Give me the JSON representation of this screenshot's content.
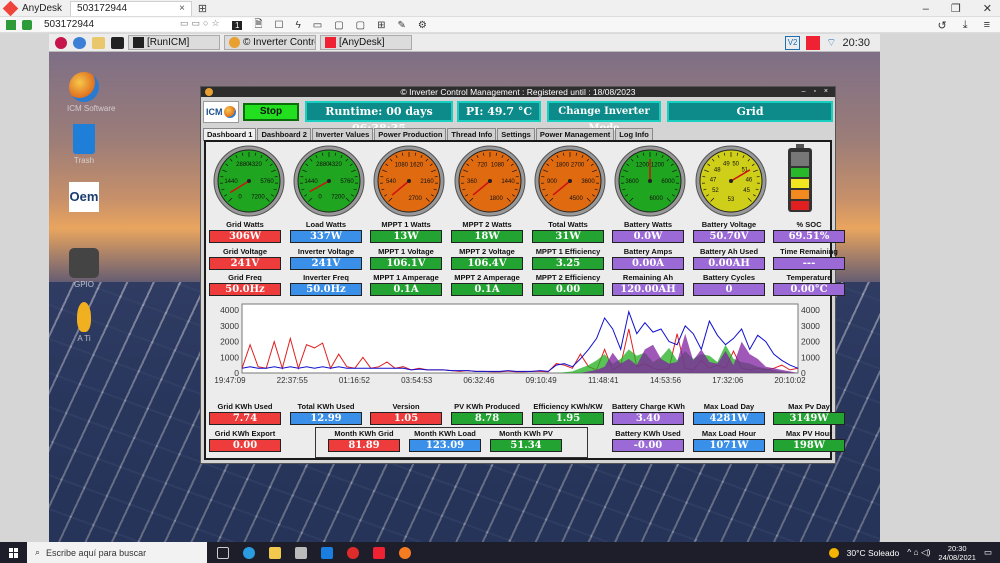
{
  "anydesk": {
    "app_name": "AnyDesk",
    "tab_label": "503172944",
    "tab_close": "×",
    "new_tab": "⊞",
    "address": "503172944",
    "toolbar_number": "1",
    "window_controls": [
      "–",
      "❐",
      "✕"
    ]
  },
  "remote_panel": {
    "tasks": [
      "[RunICM]",
      "© Inverter Control...",
      "[AnyDesk]"
    ],
    "v2": "V2",
    "clock": "20:30"
  },
  "desktop_icons": [
    {
      "label": "ICM Software",
      "icon": "icm-globe-icon"
    },
    {
      "label": "Trash",
      "icon": "trash-icon"
    },
    {
      "label": "Oem",
      "icon": "oem-icon"
    },
    {
      "label": "GPIO",
      "icon": "toggle-icon"
    },
    {
      "label": "A Ti",
      "icon": "bulb-icon"
    }
  ],
  "icm": {
    "title": "© Inverter Control Management : Registered until : 18/08/2023",
    "logo": "ICM",
    "stop_label": "Stop",
    "runtime": "Runtime: 00 days 06:38:35",
    "pi_temp": "PI: 49.7 °C",
    "change_mode": "Change Inverter Mode",
    "mode": "Grid",
    "tabs": [
      "Dashboard 1",
      "Dashboard 2",
      "Inverter Values",
      "Power Production",
      "Thread Info",
      "Settings",
      "Power Management",
      "Log Info"
    ],
    "gauges": [
      {
        "ticks": [
          "2880",
          "4320",
          "1440",
          "5760",
          "0",
          "7200"
        ],
        "color": "#1fa51f",
        "needle": 0.05
      },
      {
        "ticks": [
          "2880",
          "4320",
          "1440",
          "5760",
          "0",
          "7200"
        ],
        "color": "#1fa51f",
        "needle": 0.06
      },
      {
        "ticks": [
          "1080",
          "1620",
          "540",
          "2160",
          "2700"
        ],
        "color": "#e06a10",
        "needle": 0.02
      },
      {
        "ticks": [
          "720",
          "1080",
          "360",
          "1440",
          "1800"
        ],
        "color": "#e06a10",
        "needle": 0.02
      },
      {
        "ticks": [
          "1800",
          "2700",
          "900",
          "3600",
          "4500"
        ],
        "color": "#e06a10",
        "needle": 0.02
      },
      {
        "ticks": [
          "1200",
          "1200",
          "3600",
          "6000",
          "6000"
        ],
        "color": "#1fa51f",
        "needle": 0.5
      },
      {
        "ticks": [
          "49",
          "50",
          "48",
          "51",
          "47",
          "46",
          "52",
          "45",
          "53"
        ],
        "color": "#cfcf1a",
        "needle": 0.72
      }
    ],
    "rows": [
      [
        {
          "label": "Grid Watts",
          "value": "306W",
          "color": "red"
        },
        {
          "label": "Load Watts",
          "value": "337W",
          "color": "blue"
        },
        {
          "label": "MPPT 1 Watts",
          "value": "13W",
          "color": "green"
        },
        {
          "label": "MPPT 2 Watts",
          "value": "18W",
          "color": "green"
        },
        {
          "label": "Total Watts",
          "value": "31W",
          "color": "green"
        },
        {
          "label": "Battery Watts",
          "value": "0.0W",
          "color": "purple"
        },
        {
          "label": "Battery Voltage",
          "value": "50.70V",
          "color": "purple"
        },
        {
          "label": "% SOC",
          "value": "69.51%",
          "color": "purple"
        }
      ],
      [
        {
          "label": "Grid Voltage",
          "value": "241V",
          "color": "red"
        },
        {
          "label": "Inverter Voltage",
          "value": "241V",
          "color": "blue"
        },
        {
          "label": "MPPT 1 Voltage",
          "value": "106.1V",
          "color": "green"
        },
        {
          "label": "MPPT 2 Voltage",
          "value": "106.4V",
          "color": "green"
        },
        {
          "label": "MPPT 1 Efficiency",
          "value": "3.25",
          "color": "green"
        },
        {
          "label": "Battery Amps",
          "value": "0.00A",
          "color": "purple"
        },
        {
          "label": "Battery Ah Used",
          "value": "0.00AH",
          "color": "purple"
        },
        {
          "label": "Time Remaining",
          "value": "---",
          "color": "purple"
        }
      ],
      [
        {
          "label": "Grid Freq",
          "value": "50.0Hz",
          "color": "red"
        },
        {
          "label": "Inverter Freq",
          "value": "50.0Hz",
          "color": "blue"
        },
        {
          "label": "MPPT 1 Amperage",
          "value": "0.1A",
          "color": "green"
        },
        {
          "label": "MPPT 2 Amperage",
          "value": "0.1A",
          "color": "green"
        },
        {
          "label": "MPPT 2 Efficiency",
          "value": "0.00",
          "color": "green"
        },
        {
          "label": "Remaining Ah",
          "value": "120.00AH",
          "color": "purple"
        },
        {
          "label": "Battery Cycles",
          "value": "0",
          "color": "purple"
        },
        {
          "label": "Temperature",
          "value": "0.00°C",
          "color": "purple"
        }
      ]
    ],
    "bottom_row1": [
      {
        "label": "Grid KWh Used",
        "value": "7.74",
        "color": "red"
      },
      {
        "label": "Total KWh Used",
        "value": "12.99",
        "color": "blue"
      },
      {
        "label": "Version",
        "value": "1.05",
        "color": "red"
      },
      {
        "label": "PV KWh Produced",
        "value": "8.78",
        "color": "green"
      },
      {
        "label": "Efficiency KWh/KW",
        "value": "1.95",
        "color": "green"
      },
      {
        "label": "Battery Charge KWh",
        "value": "3.40",
        "color": "purple"
      },
      {
        "label": "Max Load Day",
        "value": "4281W",
        "color": "blue"
      },
      {
        "label": "Max Pv Day",
        "value": "3149W",
        "color": "green"
      }
    ],
    "bottom_row2_left": {
      "label": "Grid KWh Export",
      "value": "0.00",
      "color": "red"
    },
    "month": [
      {
        "label": "Month KWh Grid",
        "value": "81.89",
        "color": "red"
      },
      {
        "label": "Month KWh Load",
        "value": "123.09",
        "color": "blue"
      },
      {
        "label": "Month KWh PV",
        "value": "51.34",
        "color": "green"
      }
    ],
    "bottom_row2_right": [
      {
        "label": "Battery KWh Used",
        "value": "-0.00",
        "color": "purple"
      },
      {
        "label": "Max Load Hour",
        "value": "1071W",
        "color": "blue"
      },
      {
        "label": "Max PV Hour",
        "value": "198W",
        "color": "green"
      }
    ]
  },
  "chart_data": {
    "type": "line",
    "x_ticks": [
      "19:47:09",
      "22:37:55",
      "01:16:52",
      "03:54:53",
      "06:32:46",
      "09:10:49",
      "11:48:41",
      "14:53:56",
      "17:32:06",
      "20:10:02"
    ],
    "y_ticks": [
      0,
      1000,
      2000,
      3000,
      4000
    ],
    "ylim": [
      0,
      4200
    ],
    "grid": false,
    "series_colors": {
      "grid": "#e02020",
      "load": "#1010d0",
      "pv": "#20b020",
      "mppt": "#8a8a20",
      "battery": "#8020a0"
    },
    "series": [
      {
        "color_key": "grid",
        "values": [
          300,
          1800,
          400,
          300,
          2000,
          300,
          2200,
          300,
          1800,
          1600,
          1900,
          300,
          1200,
          400,
          300,
          1000,
          300,
          400,
          700,
          300,
          400,
          200,
          300,
          200,
          200,
          200,
          150,
          100,
          150,
          100,
          100,
          80,
          80,
          120,
          80,
          80,
          100,
          100,
          80,
          600,
          500,
          300,
          1200,
          400,
          200,
          1500,
          200,
          500,
          2800,
          400,
          600,
          300,
          200,
          300,
          2500,
          300,
          200,
          800,
          300,
          500,
          300,
          1400,
          300,
          200,
          300,
          200,
          300,
          500,
          200,
          300
        ]
      },
      {
        "color_key": "load",
        "values": [
          300,
          400,
          300,
          300,
          400,
          300,
          400,
          300,
          400,
          300,
          400,
          300,
          400,
          300,
          300,
          300,
          300,
          300,
          300,
          300,
          300,
          200,
          250,
          200,
          200,
          200,
          150,
          150,
          150,
          100,
          100,
          100,
          100,
          150,
          100,
          100,
          100,
          150,
          100,
          500,
          600,
          400,
          900,
          1500,
          2200,
          3500,
          2800,
          1500,
          3900,
          2500,
          3200,
          2600,
          2800,
          2000,
          1800,
          3000,
          2500,
          1500,
          3300,
          2400,
          1800,
          2200,
          2800,
          1500,
          2400,
          2000,
          1200,
          800,
          500,
          300
        ]
      },
      {
        "color_key": "pv",
        "values": [
          0,
          0,
          0,
          0,
          0,
          0,
          0,
          0,
          0,
          0,
          0,
          0,
          0,
          0,
          0,
          0,
          0,
          0,
          0,
          0,
          0,
          0,
          0,
          0,
          0,
          0,
          0,
          0,
          0,
          0,
          0,
          0,
          0,
          0,
          0,
          0,
          0,
          0,
          0,
          0,
          50,
          100,
          300,
          500,
          800,
          1200,
          600,
          900,
          1500,
          1100,
          1300,
          700,
          1000,
          1600,
          800,
          1400,
          900,
          1200,
          1100,
          700,
          1800,
          900,
          700,
          600,
          400,
          300,
          200,
          100,
          50,
          0
        ]
      },
      {
        "color_key": "battery",
        "values": [
          0,
          0,
          0,
          0,
          0,
          0,
          0,
          0,
          0,
          0,
          0,
          0,
          0,
          0,
          0,
          0,
          0,
          0,
          0,
          0,
          0,
          0,
          0,
          0,
          0,
          0,
          0,
          0,
          0,
          0,
          0,
          0,
          0,
          0,
          0,
          0,
          0,
          0,
          0,
          0,
          0,
          0,
          0,
          100,
          200,
          400,
          1300,
          600,
          900,
          500,
          1500,
          1800,
          900,
          600,
          700,
          2500,
          800,
          1500,
          700,
          600,
          1400,
          500,
          2000,
          1200,
          900,
          400,
          300,
          200,
          100,
          0
        ]
      }
    ]
  },
  "windows": {
    "search_placeholder": "Escribe aquí para buscar",
    "weather": "30°C  Soleado",
    "time": "20:30",
    "date": "24/08/2021"
  }
}
